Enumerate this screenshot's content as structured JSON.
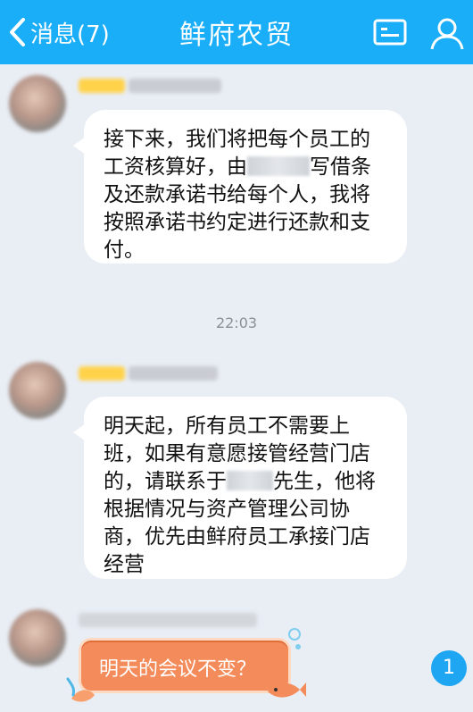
{
  "header": {
    "back_label": "消息(7)",
    "title": "鲜府农贸"
  },
  "messages": [
    {
      "lines": [
        "接下来，我们将把每个员工的",
        "工资核算好，由",
        "写借条",
        "及还款承诺书给每个人，我将",
        "按照承诺书约定进行还款和支",
        "付。"
      ]
    },
    {
      "lines": [
        "明天起，所有员工不需要上",
        "班，如果有意愿接管经营门店",
        "的，请联系于",
        "先生，他将",
        "根据情况与资产管理公司协",
        "商，优先由鲜府员工承接门店",
        "经营"
      ]
    },
    {
      "text": "明天的会议不变？"
    }
  ],
  "timestamp": "22:03",
  "unread_count": "1",
  "colors": {
    "header_bg": "#19aef7",
    "chat_bg": "#e9eef5",
    "bubble_bg": "#ffffff",
    "fancy_bubble": "#f48b5a",
    "unread_badge": "#1ea6f2"
  },
  "icons": [
    "chevron-left-icon",
    "profile-card-icon",
    "user-icon"
  ]
}
